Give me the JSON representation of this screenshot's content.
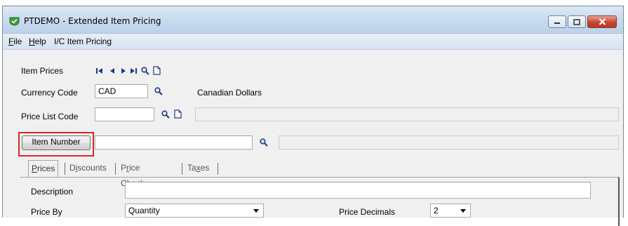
{
  "window": {
    "title": "PTDEMO - Extended Item Pricing",
    "colors": {
      "titlebar": "#c9dbee",
      "highlight": "#d9262d",
      "app_icon": "#3aa13a"
    }
  },
  "menu": {
    "items": [
      {
        "label": "File",
        "mnemonic": "F",
        "rest": "ile"
      },
      {
        "label": "Help",
        "mnemonic": "H",
        "rest": "elp"
      },
      {
        "label": "I/C Item Pricing"
      }
    ]
  },
  "item_prices": {
    "label": "Item Prices",
    "nav_icons": [
      "first-icon",
      "previous-icon",
      "next-icon",
      "last-icon",
      "search-icon",
      "new-document-icon"
    ]
  },
  "currency": {
    "label": "Currency Code",
    "value": "CAD",
    "description": "Canadian Dollars"
  },
  "price_list": {
    "label": "Price List Code",
    "value": "",
    "description": ""
  },
  "item_number": {
    "button_label": "Item Number",
    "value": "",
    "description": ""
  },
  "tabs": [
    {
      "label": "Prices",
      "mnemonic": "P",
      "rest": "rices",
      "prefix": "",
      "active": true
    },
    {
      "label": "Discounts",
      "prefix": "D",
      "mnemonic": "i",
      "rest": "scounts",
      "active": false
    },
    {
      "label": "Price Check",
      "prefix": "P",
      "mnemonic": "r",
      "rest": "ice Check",
      "active": false
    },
    {
      "label": "Taxes",
      "prefix": "Ta",
      "mnemonic": "x",
      "rest": "es",
      "active": false
    }
  ],
  "prices_tab": {
    "description_label": "Description",
    "description_value": "",
    "price_by_label": "Price By",
    "price_by_value": "Quantity",
    "price_decimals_label": "Price Decimals",
    "price_decimals_value": "2"
  }
}
